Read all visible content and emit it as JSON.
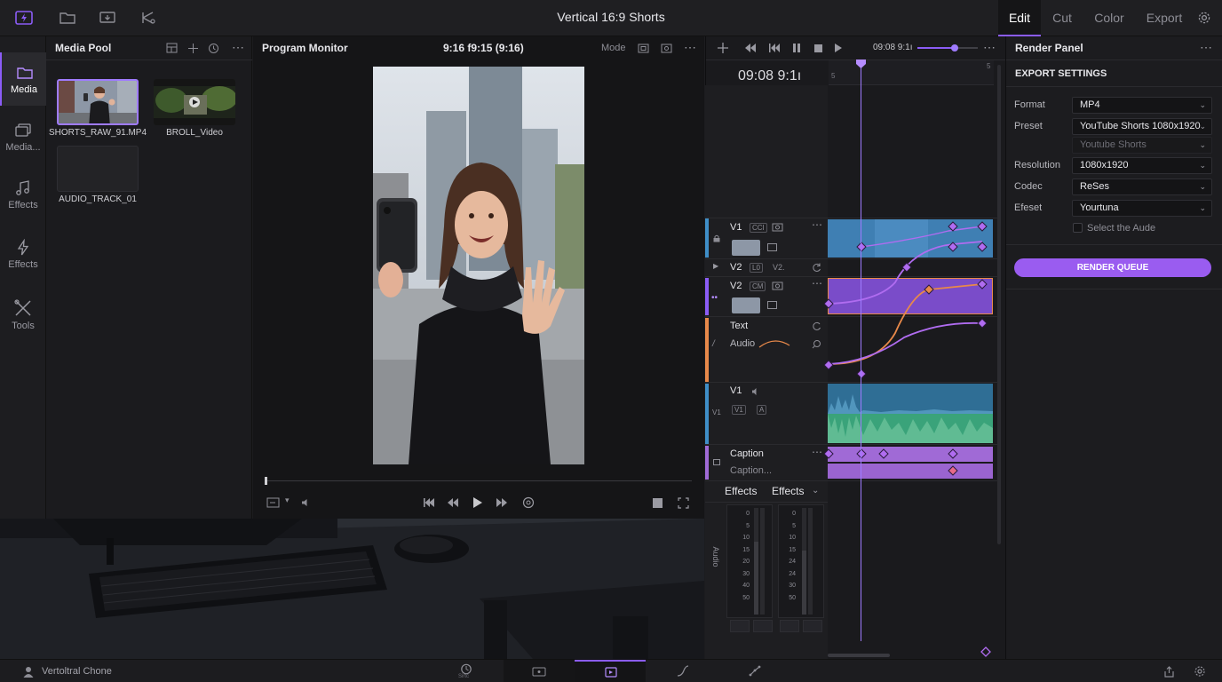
{
  "app": {
    "title": "Vertical 16:9 Shorts",
    "workspace_tabs": [
      {
        "label": "Edit",
        "active": true
      },
      {
        "label": "Cut",
        "active": false
      },
      {
        "label": "Color",
        "active": false
      },
      {
        "label": "Export",
        "active": false
      }
    ],
    "accent_color": "#8b5cf6"
  },
  "sidebar": {
    "items": [
      {
        "label": "Media",
        "icon": "folder-icon",
        "active": true
      },
      {
        "label": "Media...",
        "icon": "media-stack-icon",
        "active": false
      },
      {
        "label": "Effects",
        "icon": "music-note-icon",
        "active": false
      },
      {
        "label": "Effects",
        "icon": "lightning-icon",
        "active": false
      },
      {
        "label": "Tools",
        "icon": "tools-icon",
        "active": false
      }
    ]
  },
  "media_pool": {
    "title": "Media Pool",
    "items": [
      {
        "label": "SHORTS_RAW_91.MP4",
        "selected": true
      },
      {
        "label": "BROLL_Video",
        "selected": false
      },
      {
        "label": "AUDIO_TRACK_01",
        "selected": false
      }
    ]
  },
  "monitor": {
    "title": "Program Monitor",
    "timecode": "9:16 f9:15 (9:16)",
    "mode_label": "Mode"
  },
  "timeline": {
    "timecode": "09:08 9:1ı",
    "ruler_marks": [
      "5",
      "5"
    ],
    "tracks": [
      {
        "name": "V1",
        "tags": [
          "CCI"
        ]
      },
      {
        "name": "V2",
        "tags": [
          "L0",
          "V2."
        ]
      },
      {
        "name": "V2",
        "tags": [
          "CM"
        ]
      },
      {
        "name": "Text",
        "tags": []
      },
      {
        "name": "Audio",
        "tags": []
      },
      {
        "name": "V1",
        "tags": [
          "V1",
          "A"
        ]
      },
      {
        "name": "Caption",
        "tags": []
      },
      {
        "name": "Caption...",
        "tags": []
      }
    ],
    "left_labels": [
      "V1"
    ],
    "effects_tabs": [
      "Effects",
      "Effects"
    ],
    "meter_scale": [
      "0",
      "5",
      "10",
      "15",
      "20",
      "30",
      "40",
      "50"
    ],
    "meter_scale_right": [
      "0",
      "5",
      "10",
      "15",
      "24",
      "24",
      "30",
      "50"
    ],
    "mixer_label": "Audio"
  },
  "render_panel": {
    "title": "Render Panel",
    "section": "EXPORT SETTINGS",
    "fields": [
      {
        "label": "Format",
        "value": "MP4"
      },
      {
        "label": "Preset",
        "value": "YouTube Shorts 1080x1920"
      },
      {
        "label": "",
        "value": "Youtube Shorts"
      },
      {
        "label": "Resolution",
        "value": "1080x1920"
      },
      {
        "label": "Codec",
        "value": "ReSes"
      },
      {
        "label": "Efeset",
        "value": "Yourtuna"
      }
    ],
    "checkbox_label": "Select the Aude",
    "checkbox_checked": false,
    "render_button": "RENDER QUEUE"
  },
  "statusbar": {
    "project_name": "Vertoltral Chone",
    "page_labels": [
      "Sirtc"
    ]
  },
  "colors": {
    "video_clip": "#3f8ec7",
    "purple_clip": "#7a4cc9",
    "audio_wave": "#3aa37a",
    "caption_clip": "#a06ad6",
    "curve_orange": "#e8894a",
    "curve_purple": "#b06cf0"
  }
}
